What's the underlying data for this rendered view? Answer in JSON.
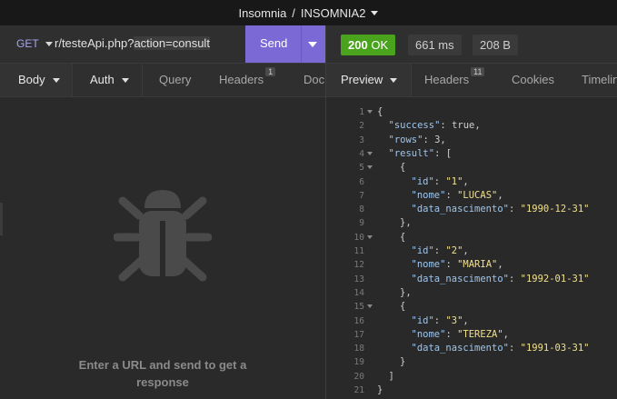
{
  "window": {
    "app": "Insomnia",
    "separator": "/",
    "workspace": "INSOMNIA2"
  },
  "request": {
    "method": "GET",
    "url_prefix": "r/testeApi.php?",
    "url_highlight": "action=consult",
    "send_label": "Send"
  },
  "request_tabs": [
    {
      "label": "Body",
      "dropdown": true,
      "active": true
    },
    {
      "label": "Auth",
      "dropdown": true,
      "active": false
    },
    {
      "label": "Query",
      "dropdown": false,
      "active": false
    },
    {
      "label": "Headers",
      "badge": "1",
      "active": false
    },
    {
      "label": "Doc",
      "active": false
    }
  ],
  "empty_state": {
    "icon": "bug-icon",
    "text_line1": "Enter a URL and send to get a",
    "text_line2": "response"
  },
  "response": {
    "status": "200",
    "status_text": "OK",
    "time": "661 ms",
    "size": "208 B",
    "status_color": "#4aa31c",
    "accent_color": "#7b6ad6"
  },
  "response_tabs": [
    {
      "label": "Preview",
      "dropdown": true,
      "active": true
    },
    {
      "label": "Headers",
      "badge": "11",
      "active": false
    },
    {
      "label": "Cookies",
      "active": false
    },
    {
      "label": "Timeline",
      "active": false
    }
  ],
  "json_lines": [
    {
      "n": "1",
      "fold": true,
      "indent": 0,
      "parts": [
        [
          "b",
          "{"
        ]
      ]
    },
    {
      "n": "2",
      "indent": 1,
      "parts": [
        [
          "k",
          "\"success\""
        ],
        [
          "b",
          ": "
        ],
        [
          "n",
          "true"
        ],
        [
          "b",
          ","
        ]
      ]
    },
    {
      "n": "3",
      "indent": 1,
      "parts": [
        [
          "k",
          "\"rows\""
        ],
        [
          "b",
          ": "
        ],
        [
          "n",
          "3"
        ],
        [
          "b",
          ","
        ]
      ]
    },
    {
      "n": "4",
      "fold": true,
      "indent": 1,
      "parts": [
        [
          "k",
          "\"result\""
        ],
        [
          "b",
          ": ["
        ]
      ]
    },
    {
      "n": "5",
      "fold": true,
      "indent": 2,
      "parts": [
        [
          "b",
          "{"
        ]
      ]
    },
    {
      "n": "6",
      "indent": 3,
      "parts": [
        [
          "k",
          "\"id\""
        ],
        [
          "b",
          ": "
        ],
        [
          "s",
          "\"1\""
        ],
        [
          "b",
          ","
        ]
      ]
    },
    {
      "n": "7",
      "indent": 3,
      "parts": [
        [
          "k",
          "\"nome\""
        ],
        [
          "b",
          ": "
        ],
        [
          "s",
          "\"LUCAS\""
        ],
        [
          "b",
          ","
        ]
      ]
    },
    {
      "n": "8",
      "indent": 3,
      "parts": [
        [
          "k",
          "\"data_nascimento\""
        ],
        [
          "b",
          ": "
        ],
        [
          "s",
          "\"1990-12-31\""
        ]
      ]
    },
    {
      "n": "9",
      "indent": 2,
      "parts": [
        [
          "b",
          "},"
        ]
      ]
    },
    {
      "n": "10",
      "fold": true,
      "indent": 2,
      "parts": [
        [
          "b",
          "{"
        ]
      ]
    },
    {
      "n": "11",
      "indent": 3,
      "parts": [
        [
          "k",
          "\"id\""
        ],
        [
          "b",
          ": "
        ],
        [
          "s",
          "\"2\""
        ],
        [
          "b",
          ","
        ]
      ]
    },
    {
      "n": "12",
      "indent": 3,
      "parts": [
        [
          "k",
          "\"nome\""
        ],
        [
          "b",
          ": "
        ],
        [
          "s",
          "\"MARIA\""
        ],
        [
          "b",
          ","
        ]
      ]
    },
    {
      "n": "13",
      "indent": 3,
      "parts": [
        [
          "k",
          "\"data_nascimento\""
        ],
        [
          "b",
          ": "
        ],
        [
          "s",
          "\"1992-01-31\""
        ]
      ]
    },
    {
      "n": "14",
      "indent": 2,
      "parts": [
        [
          "b",
          "},"
        ]
      ]
    },
    {
      "n": "15",
      "fold": true,
      "indent": 2,
      "parts": [
        [
          "b",
          "{"
        ]
      ]
    },
    {
      "n": "16",
      "indent": 3,
      "parts": [
        [
          "k",
          "\"id\""
        ],
        [
          "b",
          ": "
        ],
        [
          "s",
          "\"3\""
        ],
        [
          "b",
          ","
        ]
      ]
    },
    {
      "n": "17",
      "indent": 3,
      "parts": [
        [
          "k",
          "\"nome\""
        ],
        [
          "b",
          ": "
        ],
        [
          "s",
          "\"TEREZA\""
        ],
        [
          "b",
          ","
        ]
      ]
    },
    {
      "n": "18",
      "indent": 3,
      "parts": [
        [
          "k",
          "\"data_nascimento\""
        ],
        [
          "b",
          ": "
        ],
        [
          "s",
          "\"1991-03-31\""
        ]
      ]
    },
    {
      "n": "19",
      "indent": 2,
      "parts": [
        [
          "b",
          "}"
        ]
      ]
    },
    {
      "n": "20",
      "indent": 1,
      "parts": [
        [
          "b",
          "]"
        ]
      ]
    },
    {
      "n": "21",
      "indent": 0,
      "parts": [
        [
          "b",
          "}"
        ]
      ]
    }
  ]
}
